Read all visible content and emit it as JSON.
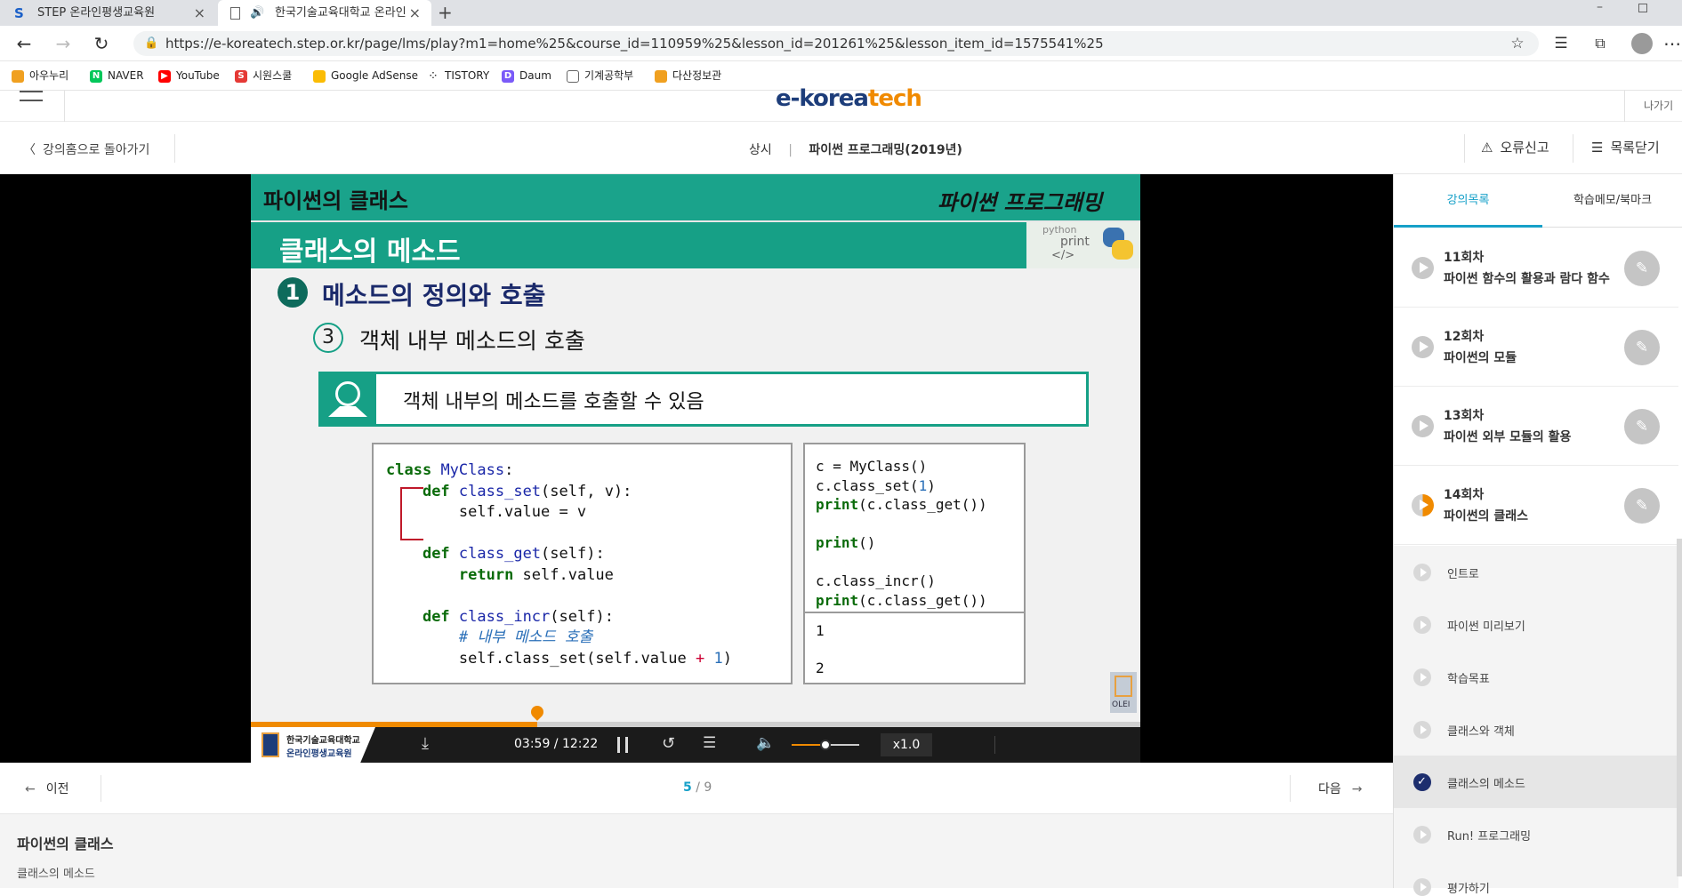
{
  "browser": {
    "tabs": [
      {
        "title": "STEP 온라인평생교육원"
      },
      {
        "title": "한국기술교육대학교 온라인"
      }
    ],
    "url": "https://e-koreatech.step.or.kr/page/lms/play?m1=home%25&course_id=110959%25&lesson_id=201261%25&lesson_item_id=1575541%25",
    "bookmarks": [
      {
        "label": "아우누리",
        "icon": "hanbat-icon",
        "color": "#f0a020"
      },
      {
        "label": "NAVER",
        "icon": "naver-icon",
        "color": "#03c75a"
      },
      {
        "label": "YouTube",
        "icon": "youtube-icon",
        "color": "#ff0000"
      },
      {
        "label": "시원스쿨",
        "icon": "siwon-icon",
        "color": "#e53935"
      },
      {
        "label": "Google AdSense",
        "icon": "adsense-icon",
        "color": "#fbbc04"
      },
      {
        "label": "TISTORY",
        "icon": "tistory-icon",
        "color": "#333333"
      },
      {
        "label": "Daum",
        "icon": "daum-icon",
        "color": "#7a5af8"
      },
      {
        "label": "기계공학부",
        "icon": "page-icon",
        "color": "#777777"
      },
      {
        "label": "다산정보관",
        "icon": "hanbat-icon",
        "color": "#f0a020"
      }
    ]
  },
  "header": {
    "logo_prefix": "e-korea",
    "logo_suffix": "tech",
    "exit_label": "나가기"
  },
  "subnav": {
    "back_label": "강의홈으로 돌아가기",
    "category": "상시",
    "separator": "|",
    "course_title": "파이썬 프로그래밍(2019년)",
    "report_label": "오류신고",
    "close_list_label": "목록닫기"
  },
  "slide": {
    "chapter": "파이썬의 클래스",
    "brand": "파이썬 프로그래밍",
    "banner": "클래스의 메소드",
    "deco_python": "python",
    "deco_print": "print",
    "deco_tag": "</>",
    "section_num": "1",
    "section_title": "메소드의 정의와 호출",
    "sub_num": "3",
    "sub_title": "객체 내부 메소드의 호출",
    "note": "객체 내부의 메소드를 호출할 수 있음",
    "output_1": "1",
    "output_2": "2",
    "olei": "OLEI"
  },
  "controls": {
    "university": "한국기술교육대학교",
    "institute": "온라인평생교육원",
    "current_time": "03:59",
    "total_time": "12:22",
    "time_sep": " / ",
    "speed": "x1.0",
    "progress": 0.322
  },
  "panel": {
    "tabs": [
      "강의목록",
      "학습메모/북마크"
    ],
    "lectures": [
      {
        "num": "11회차",
        "title": "파이썬 함수의 활용과 람다 함수"
      },
      {
        "num": "12회차",
        "title": "파이썬의 모듈"
      },
      {
        "num": "13회차",
        "title": "파이썬 외부 모듈의 활용"
      },
      {
        "num": "14회차",
        "title": "파이썬의 클래스"
      }
    ],
    "items": [
      {
        "label": "인트로"
      },
      {
        "label": "파이썬 미리보기"
      },
      {
        "label": "학습목표"
      },
      {
        "label": "클래스와 객체"
      },
      {
        "label": "클래스의 메소드"
      },
      {
        "label": "Run! 프로그래밍"
      },
      {
        "label": "평가하기"
      }
    ]
  },
  "pager": {
    "prev_label": "이전",
    "next_label": "다음",
    "current": "5",
    "sep": " / ",
    "total": "9"
  },
  "description": {
    "title": "파이썬의 클래스",
    "subtitle": "클래스의 메소드"
  }
}
